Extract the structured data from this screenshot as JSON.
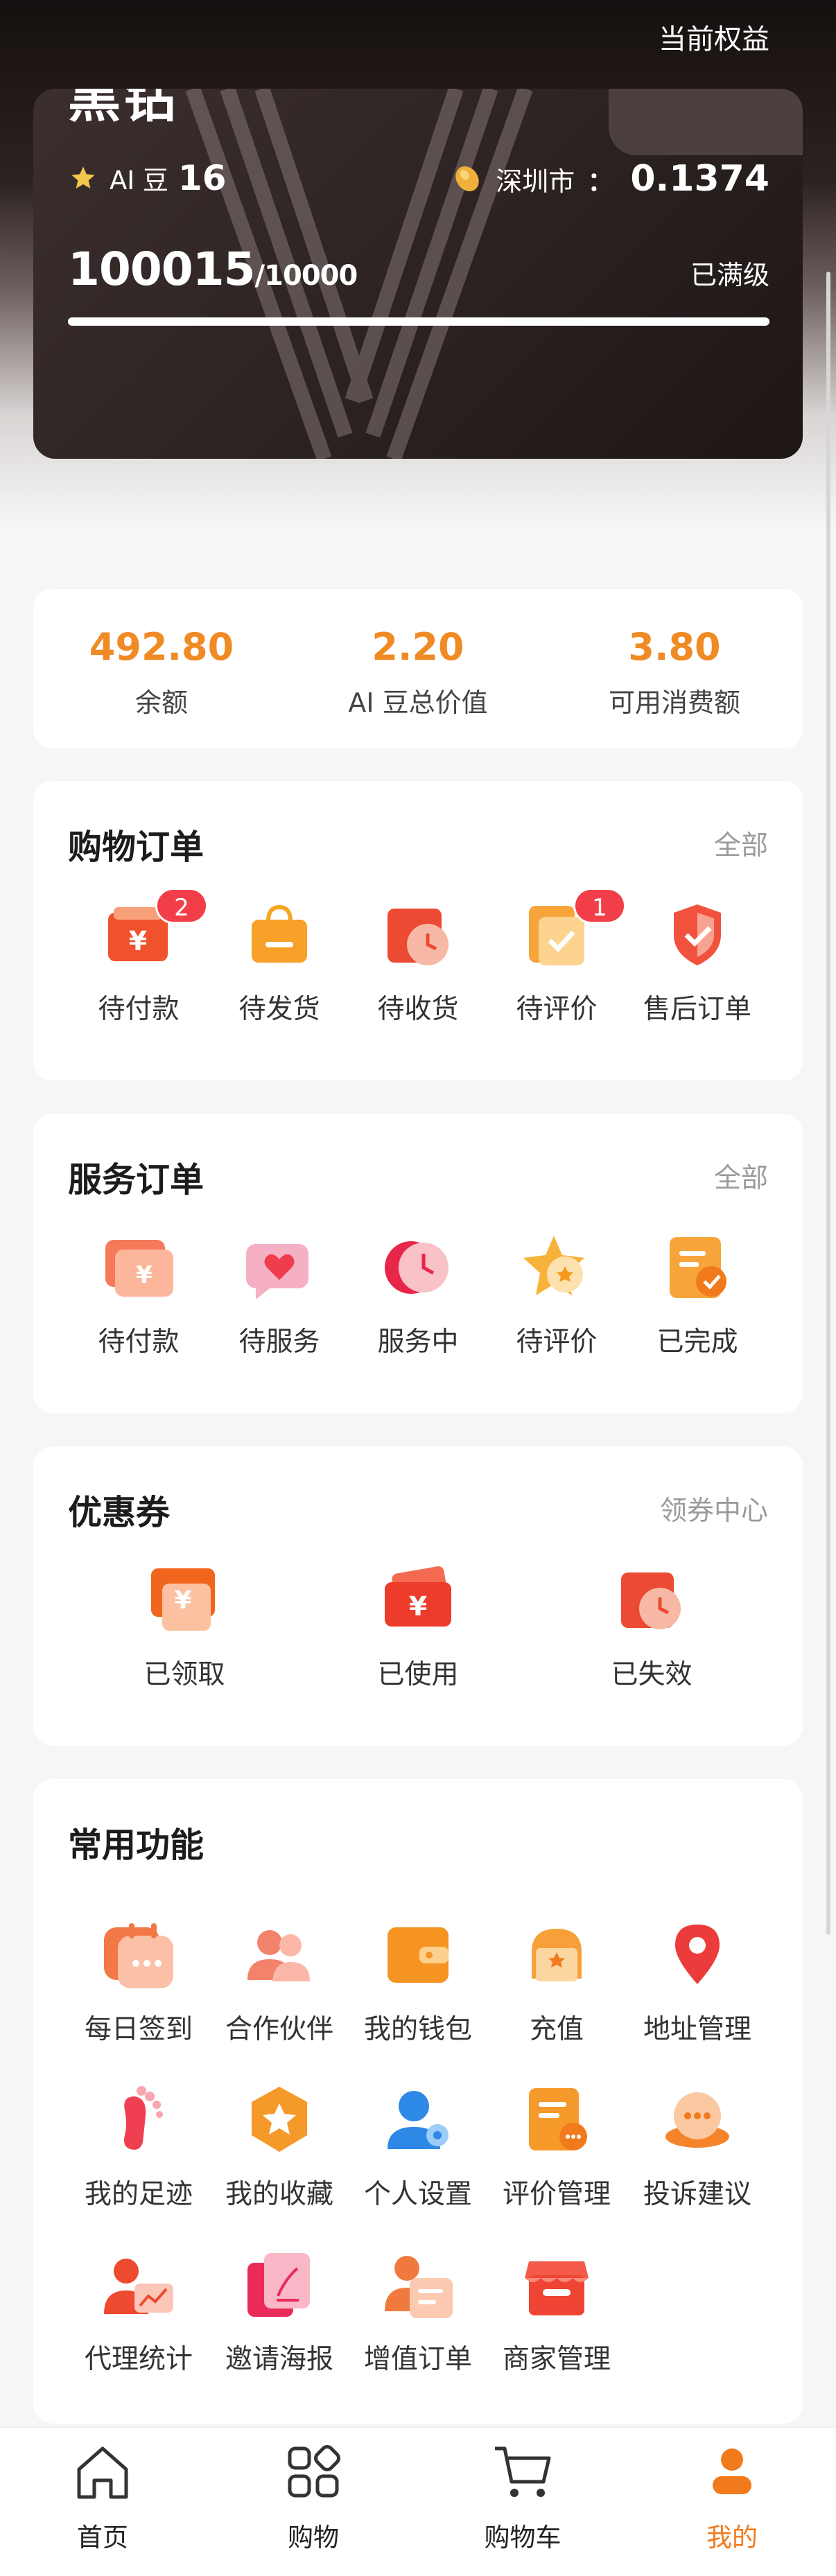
{
  "header": {
    "benefits_link": "当前权益"
  },
  "vip": {
    "level": "黑钻",
    "ai_bean_label": "AI 豆",
    "ai_bean_value": "16",
    "city_label": "深圳市",
    "city_sep": "：",
    "city_value": "0.1374",
    "progress_current": "100015",
    "progress_total": "/10000",
    "progress_status": "已满级",
    "progress_ratio": 1.0
  },
  "balance": {
    "items": [
      {
        "value": "492.80",
        "label": "余额"
      },
      {
        "value": "2.20",
        "label": "AI 豆总价值"
      },
      {
        "value": "3.80",
        "label": "可用消费额"
      }
    ]
  },
  "shopping_orders": {
    "title": "购物订单",
    "link": "全部",
    "items": [
      {
        "label": "待付款",
        "icon": "wallet-yen-icon",
        "badge": "2"
      },
      {
        "label": "待发货",
        "icon": "shopping-bag-icon",
        "badge": ""
      },
      {
        "label": "待收货",
        "icon": "clock-box-icon",
        "badge": ""
      },
      {
        "label": "待评价",
        "icon": "check-doc-icon",
        "badge": "1"
      },
      {
        "label": "售后订单",
        "icon": "shield-check-icon",
        "badge": ""
      }
    ]
  },
  "service_orders": {
    "title": "服务订单",
    "link": "全部",
    "items": [
      {
        "label": "待付款",
        "icon": "yen-card-icon"
      },
      {
        "label": "待服务",
        "icon": "heart-chat-icon"
      },
      {
        "label": "服务中",
        "icon": "clock-circle-icon"
      },
      {
        "label": "待评价",
        "icon": "star-icon"
      },
      {
        "label": "已完成",
        "icon": "doc-check-icon"
      }
    ]
  },
  "coupons": {
    "title": "优惠券",
    "link": "领券中心",
    "items": [
      {
        "label": "已领取",
        "icon": "coupon-received-icon"
      },
      {
        "label": "已使用",
        "icon": "coupon-used-icon"
      },
      {
        "label": "已失效",
        "icon": "coupon-expired-icon"
      }
    ]
  },
  "functions": {
    "title": "常用功能",
    "items": [
      {
        "label": "每日签到",
        "icon": "calendar-icon"
      },
      {
        "label": "合作伙伴",
        "icon": "partners-icon"
      },
      {
        "label": "我的钱包",
        "icon": "wallet-icon"
      },
      {
        "label": "充值",
        "icon": "recharge-icon"
      },
      {
        "label": "地址管理",
        "icon": "location-pin-icon"
      },
      {
        "label": "我的足迹",
        "icon": "footprint-icon"
      },
      {
        "label": "我的收藏",
        "icon": "favorite-star-icon"
      },
      {
        "label": "个人设置",
        "icon": "user-settings-icon"
      },
      {
        "label": "评价管理",
        "icon": "review-manage-icon"
      },
      {
        "label": "投诉建议",
        "icon": "complaint-chat-icon"
      },
      {
        "label": "代理统计",
        "icon": "agent-stats-icon"
      },
      {
        "label": "邀请海报",
        "icon": "invite-poster-icon"
      },
      {
        "label": "增值订单",
        "icon": "value-order-icon"
      },
      {
        "label": "商家管理",
        "icon": "shop-manage-icon"
      }
    ]
  },
  "tabbar": {
    "items": [
      {
        "label": "首页",
        "icon": "home-icon"
      },
      {
        "label": "购物",
        "icon": "grid-icon"
      },
      {
        "label": "购物车",
        "icon": "cart-icon"
      },
      {
        "label": "我的",
        "icon": "profile-icon"
      }
    ],
    "active_index": 3
  },
  "colors": {
    "accent": "#f07a1c",
    "number_orange": "#f08a24",
    "badge_red": "#f23e48"
  }
}
